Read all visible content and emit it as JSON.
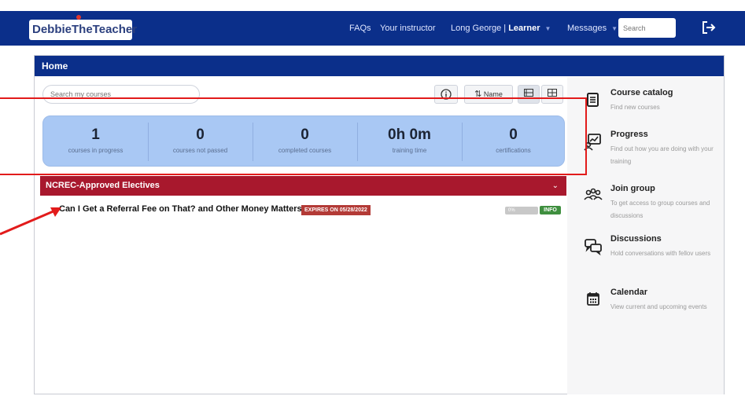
{
  "header": {
    "logo_text": "DebbieTheTeacher",
    "nav": {
      "faqs": "FAQs",
      "instructor": "Your instructor",
      "user_name": "Long George | ",
      "user_role": "Learner",
      "messages": "Messages"
    },
    "search_placeholder": "Search"
  },
  "panel": {
    "title": "Home",
    "search_placeholder": "Search my courses",
    "toolbar": {
      "sort_label": "Name"
    },
    "stats": [
      {
        "value": "1",
        "label": "courses in progress"
      },
      {
        "value": "0",
        "label": "courses not passed"
      },
      {
        "value": "0",
        "label": "completed courses"
      },
      {
        "value": "0h 0m",
        "label": "training time"
      },
      {
        "value": "0",
        "label": "certifications"
      }
    ],
    "category": {
      "title": "NCREC-Approved Electives"
    },
    "course": {
      "title": "Can I Get a Referral Fee on That? and Other Money Matters",
      "expires": "EXPIRES ON 05/28/2022",
      "progress_text": "0%",
      "progress_value": 0,
      "info_label": "INFO"
    }
  },
  "sidebar": {
    "items": [
      {
        "title": "Course catalog",
        "desc": "Find new courses",
        "icon": "catalog-icon"
      },
      {
        "title": "Progress",
        "desc": "Find out how you are doing with your training",
        "icon": "progress-icon"
      },
      {
        "title": "Join group",
        "desc": "To get access to group courses and discussions",
        "icon": "group-icon"
      },
      {
        "title": "Discussions",
        "desc": "Hold conversations with fellov users",
        "icon": "discussions-icon"
      },
      {
        "title": "Calendar",
        "desc": "View current and upcoming events",
        "icon": "calendar-icon"
      }
    ]
  },
  "colors": {
    "header_blue": "#0b2f8a",
    "category_red": "#a8182d",
    "stats_blue": "#a9c8f4",
    "annotation_red": "#e21b1b"
  }
}
